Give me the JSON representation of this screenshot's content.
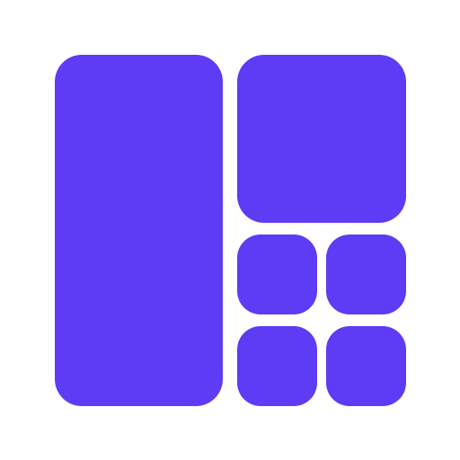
{
  "icon": {
    "name": "grid-layout-icon",
    "color": "#5E3BF5",
    "background": "#FFFFFF"
  }
}
